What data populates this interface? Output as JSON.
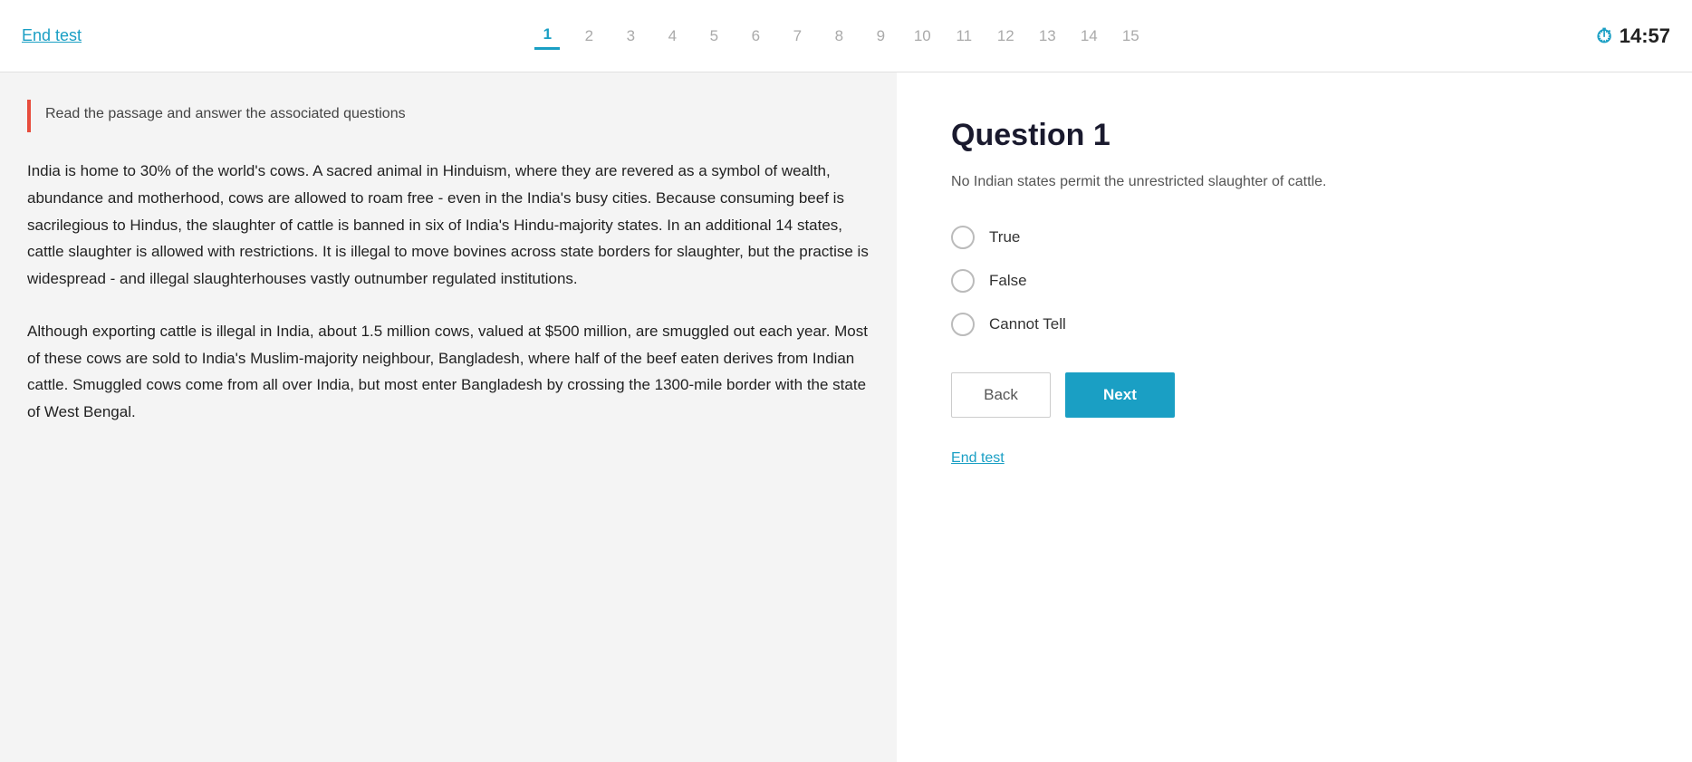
{
  "header": {
    "end_test_label": "End test",
    "question_numbers": [
      "1",
      "2",
      "3",
      "4",
      "5",
      "6",
      "7",
      "8",
      "9",
      "10",
      "11",
      "12",
      "13",
      "14",
      "15"
    ],
    "active_question": 0,
    "timer": "14:57"
  },
  "passage": {
    "instruction": "Read the passage and answer the associated questions",
    "paragraphs": [
      "India is home to 30% of the world's cows. A sacred animal in Hinduism, where they are revered as a symbol of wealth, abundance and motherhood, cows are allowed to roam free - even in the India's busy cities. Because consuming beef is sacrilegious to Hindus, the slaughter of cattle is banned in six of India's Hindu-majority states. In an additional 14 states, cattle slaughter is allowed with restrictions. It is illegal to move bovines across state borders for slaughter, but the practise is widespread - and illegal slaughterhouses vastly outnumber regulated institutions.",
      "Although exporting cattle is illegal in India, about 1.5 million cows, valued at $500 million, are smuggled out each year. Most of these cows are sold to India's Muslim-majority neighbour, Bangladesh, where half of the beef eaten derives from Indian cattle. Smuggled cows come from all over India, but most enter Bangladesh by crossing the 1300-mile border with the state of West Bengal."
    ]
  },
  "question": {
    "title": "Question 1",
    "body": "No Indian states permit the unrestricted slaughter of cattle.",
    "options": [
      {
        "label": "True",
        "value": "true"
      },
      {
        "label": "False",
        "value": "false"
      },
      {
        "label": "Cannot Tell",
        "value": "cannot_tell"
      }
    ],
    "back_label": "Back",
    "next_label": "Next",
    "end_test_label": "End test"
  },
  "icons": {
    "timer": "⏱"
  }
}
